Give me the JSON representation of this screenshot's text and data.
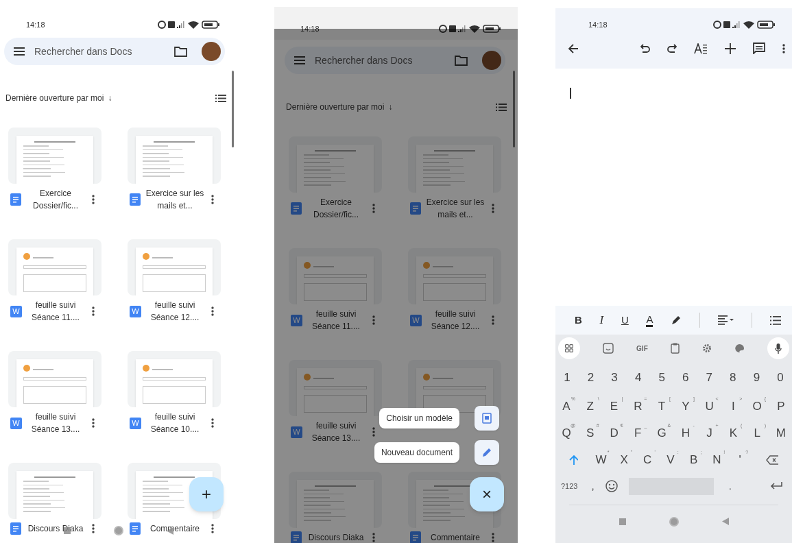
{
  "screens": [
    {
      "kind": "file_list",
      "dimmed": false,
      "status_bar": {
        "time": "14:18"
      },
      "search": {
        "placeholder": "Rechercher dans Docs"
      },
      "sort": {
        "label": "Dernière ouverture par moi",
        "arrow": "↓"
      },
      "files": [
        {
          "kind": "docs",
          "name": "Exercice Dossier/fic..."
        },
        {
          "kind": "docs",
          "name": "Exercice sur les mails et..."
        },
        {
          "kind": "word",
          "icon_letter": "W",
          "name": "feuille suivi Séance 11...."
        },
        {
          "kind": "word",
          "icon_letter": "W",
          "name": "feuille suivi Séance 12...."
        },
        {
          "kind": "word",
          "icon_letter": "W",
          "name": "feuille suivi Séance 13...."
        },
        {
          "kind": "word",
          "icon_letter": "W",
          "name": "feuille suivi Séance 10...."
        },
        {
          "kind": "docs",
          "name": "Discours Diaka"
        },
        {
          "kind": "docs",
          "name": "Commentaire"
        }
      ],
      "fab": {
        "label": "+"
      }
    },
    {
      "kind": "file_list",
      "dimmed": true,
      "status_bar": {
        "time": "14:18"
      },
      "search": {
        "placeholder": "Rechercher dans Docs"
      },
      "sort": {
        "label": "Dernière ouverture par moi",
        "arrow": "↓"
      },
      "files": [
        {
          "kind": "docs",
          "name": "Exercice Dossier/fic..."
        },
        {
          "kind": "docs",
          "name": "Exercice sur les mails et..."
        },
        {
          "kind": "word",
          "icon_letter": "W",
          "name": "feuille suivi Séance 11...."
        },
        {
          "kind": "word",
          "icon_letter": "W",
          "name": "feuille suivi Séance 12...."
        },
        {
          "kind": "word",
          "icon_letter": "W",
          "name": "feuille suivi Séance 13...."
        },
        {
          "kind": "covered"
        },
        {
          "kind": "docs",
          "name": "Discours Diaka"
        },
        {
          "kind": "docs",
          "name": "Commentaire"
        }
      ],
      "fab": {
        "label": "×"
      },
      "fab_menu": [
        {
          "label": "Choisir un modèle"
        },
        {
          "label": "Nouveau document"
        }
      ]
    },
    {
      "kind": "editor",
      "status_bar": {
        "time": "14:18"
      },
      "format_bar": [
        {
          "kind": "bold",
          "label": "B"
        },
        {
          "kind": "italic",
          "label": "I"
        },
        {
          "kind": "underline",
          "label": "U"
        },
        {
          "kind": "text_color",
          "label": "A"
        },
        {
          "kind": "highlighter"
        },
        {
          "kind": "divider"
        },
        {
          "kind": "align"
        },
        {
          "kind": "divider"
        },
        {
          "kind": "list"
        }
      ],
      "keyboard": {
        "gif": "GIF",
        "number_row": [
          "1",
          "2",
          "3",
          "4",
          "5",
          "6",
          "7",
          "8",
          "9",
          "0"
        ],
        "letter_rows": [
          [
            {
              "key": "A",
              "hint": "%"
            },
            {
              "key": "Z",
              "hint": "\\"
            },
            {
              "key": "E",
              "hint": "|"
            },
            {
              "key": "R",
              "hint": "="
            },
            {
              "key": "T",
              "hint": "["
            },
            {
              "key": "Y",
              "hint": "]"
            },
            {
              "key": "U",
              "hint": "<"
            },
            {
              "key": "I",
              "hint": ">"
            },
            {
              "key": "O",
              "hint": "{"
            },
            {
              "key": "P"
            }
          ],
          [
            {
              "key": "Q",
              "hint": "@"
            },
            {
              "key": "S",
              "hint": "#"
            },
            {
              "key": "D",
              "hint": "€"
            },
            {
              "key": "F",
              "hint": "_"
            },
            {
              "key": "G",
              "hint": "&"
            },
            {
              "key": "H",
              "hint": "-"
            },
            {
              "key": "J",
              "hint": "+"
            },
            {
              "key": "K",
              "hint": "("
            },
            {
              "key": "L",
              "hint": ")"
            },
            {
              "key": "M"
            }
          ],
          [
            {
              "key": "W",
              "hint": "*"
            },
            {
              "key": "X",
              "hint": "\""
            },
            {
              "key": "C",
              "hint": "'"
            },
            {
              "key": "V",
              "hint": ":"
            },
            {
              "key": "B",
              "hint": ";"
            },
            {
              "key": "N",
              "hint": "!"
            },
            {
              "key": "'",
              "hint": "?"
            }
          ]
        ],
        "symbols_key": "?123",
        "comma": ",",
        "period": "."
      }
    }
  ]
}
